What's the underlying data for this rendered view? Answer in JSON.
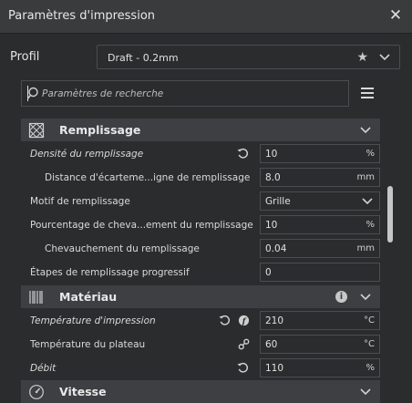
{
  "window": {
    "title": "Paramètres d'impression"
  },
  "profile": {
    "label": "Profil",
    "value": "Draft - 0.2mm"
  },
  "search": {
    "placeholder": "Paramètres de recherche"
  },
  "categories": {
    "infill": {
      "label": "Remplissage"
    },
    "material": {
      "label": "Matériau"
    },
    "speed": {
      "label": "Vitesse"
    }
  },
  "settings": [
    {
      "label": "Densité du remplissage",
      "value": "10",
      "unit": "%"
    },
    {
      "label": "Distance d'écarteme...igne de remplissage",
      "value": "8.0",
      "unit": "mm"
    },
    {
      "label": "Motif de remplissage",
      "value": "Grille",
      "unit": ""
    },
    {
      "label": "Pourcentage de cheva...ement du remplissage",
      "value": "10",
      "unit": "%"
    },
    {
      "label": "Chevauchement du remplissage",
      "value": "0.04",
      "unit": "mm"
    },
    {
      "label": "Étapes de remplissage progressif",
      "value": "0",
      "unit": ""
    },
    {
      "label": "Température d'impression",
      "value": "210",
      "unit": "°C"
    },
    {
      "label": "Température du plateau",
      "value": "60",
      "unit": "°C"
    },
    {
      "label": "Débit",
      "value": "110",
      "unit": "%"
    }
  ],
  "colors": {
    "background": "#2b2c2e",
    "category_bar": "#3d3f42",
    "border": "#4c4d50",
    "text": "#dadada"
  },
  "icons": [
    "close-icon",
    "star-icon",
    "chevron-down-icon",
    "search-icon",
    "menu-icon",
    "infill-icon",
    "material-icon",
    "speed-icon",
    "reset-icon",
    "info-icon",
    "link-icon"
  ]
}
